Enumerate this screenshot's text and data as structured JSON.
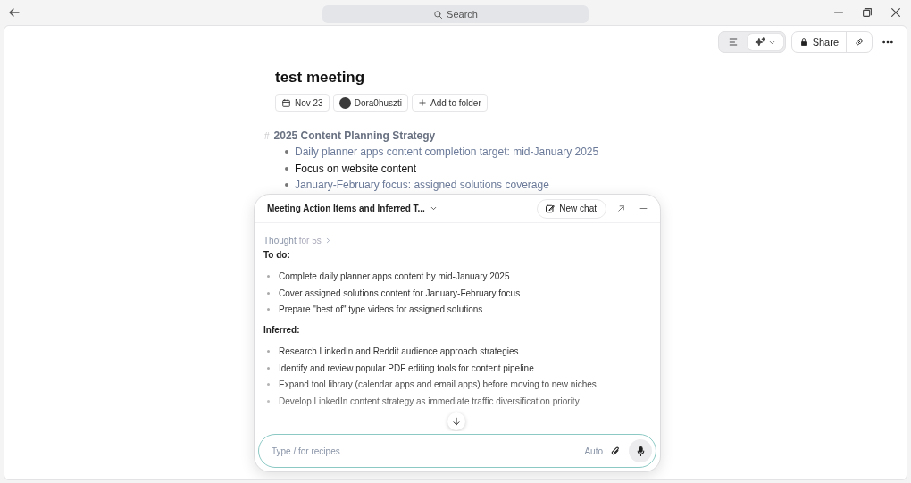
{
  "window": {
    "search_placeholder": "Search"
  },
  "toolbar": {
    "view_toggle": [
      {
        "kind": "outline",
        "selected": false
      },
      {
        "kind": "ai",
        "selected": true
      }
    ],
    "share_label": "Share"
  },
  "note": {
    "title": "test meeting",
    "date": "Nov 23",
    "author": "Dora0huszti",
    "folder_button": "Add to folder",
    "heading_mark": "#",
    "heading": "2025 Content Planning Strategy",
    "bullets": [
      {
        "text": "Daily planner apps content completion target: mid-January 2025",
        "emphasized": false
      },
      {
        "text": "Focus on website content",
        "emphasized": true
      },
      {
        "text": "January-February focus: assigned solutions coverage",
        "emphasized": false
      }
    ]
  },
  "chat": {
    "title": "Meeting Action Items and Inferred T...",
    "new_chat": "New chat",
    "thought": "Thought",
    "thought_duration": "for 5s",
    "sections": [
      {
        "heading": "To do:",
        "items": [
          "Complete daily planner apps content by mid-January 2025",
          "Cover assigned solutions content for January-February focus",
          "Prepare \"best of\" type videos for assigned solutions"
        ]
      },
      {
        "heading": "Inferred:",
        "items": [
          "Research LinkedIn and Reddit audience approach strategies",
          "Identify and review popular PDF editing tools for content pipeline",
          "Expand tool library (calendar apps and email apps) before moving to new niches",
          "Develop LinkedIn content strategy as immediate traffic diversification priority"
        ]
      }
    ],
    "input": {
      "placeholder": "Type / for recipes",
      "mode": "Auto"
    }
  }
}
